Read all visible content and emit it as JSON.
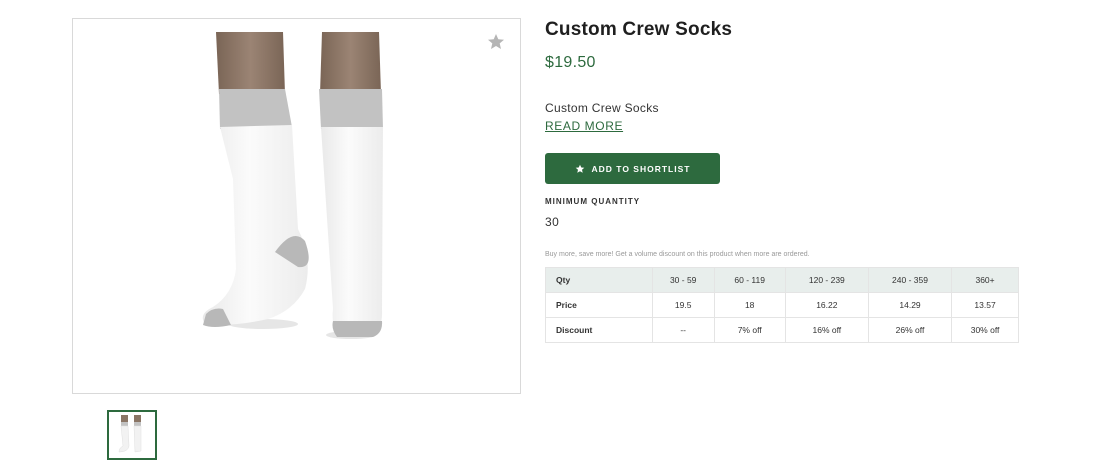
{
  "product": {
    "title": "Custom Crew Socks",
    "price": "$19.50",
    "description": "Custom Crew Socks",
    "read_more_label": "READ MORE"
  },
  "gallery": {
    "main_image_icon": "crew-socks-photo",
    "favorite_icon": "star-icon",
    "thumbnail_icon": "crew-socks-thumbnail"
  },
  "actions": {
    "shortlist_label": "ADD TO SHORTLIST",
    "shortlist_icon": "star-icon"
  },
  "minimum_quantity": {
    "label": "MINIMUM QUANTITY",
    "value": "30"
  },
  "bulk_pricing": {
    "note": "Buy more, save more! Get a volume discount on this product when more are ordered.",
    "header": [
      "Qty",
      "30 - 59",
      "60 - 119",
      "120 - 239",
      "240 - 359",
      "360+"
    ],
    "rows": [
      [
        "Price",
        "19.5",
        "18",
        "16.22",
        "14.29",
        "13.57"
      ],
      [
        "Discount",
        "--",
        "7% off",
        "16% off",
        "26% off",
        "30% off"
      ]
    ]
  },
  "colors": {
    "brand_green": "#2d6a3e",
    "table_header_bg": "#e8eeec",
    "sock_white": "#f7f7f7",
    "sock_gray": "#c4c4c4",
    "skin": "#8a7565"
  }
}
